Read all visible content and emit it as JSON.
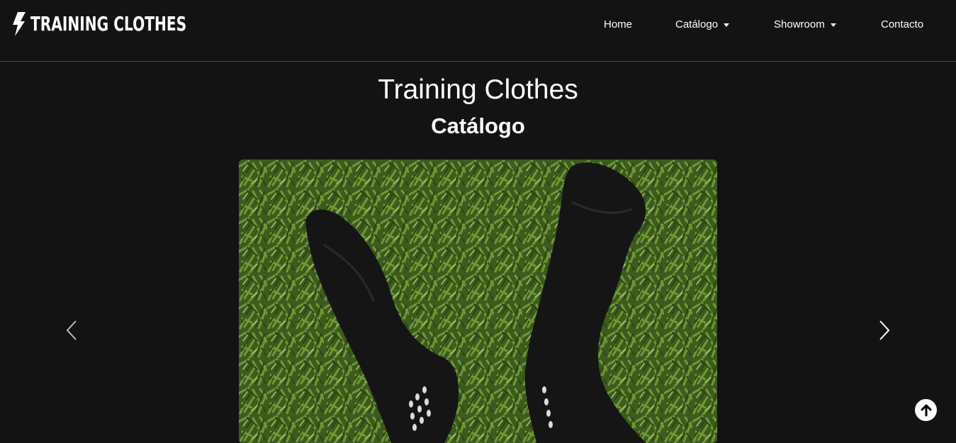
{
  "brand": {
    "text": "TRAINING CLOTHES",
    "icon": "lightning-bolt-icon"
  },
  "nav": {
    "home": "Home",
    "catalogo": "Catálogo",
    "showroom": "Showroom",
    "contacto": "Contacto"
  },
  "hero": {
    "title": "Training Clothes",
    "subtitle": "Catálogo"
  },
  "carousel": {
    "image": "black-grip-socks-on-grass",
    "prev_icon": "chevron-left-icon",
    "next_icon": "chevron-right-icon"
  },
  "scroll_top": {
    "icon": "arrow-up-circle-icon"
  },
  "colors": {
    "background": "#131313",
    "text": "#ffffff",
    "divider": "#4a4a4a"
  }
}
